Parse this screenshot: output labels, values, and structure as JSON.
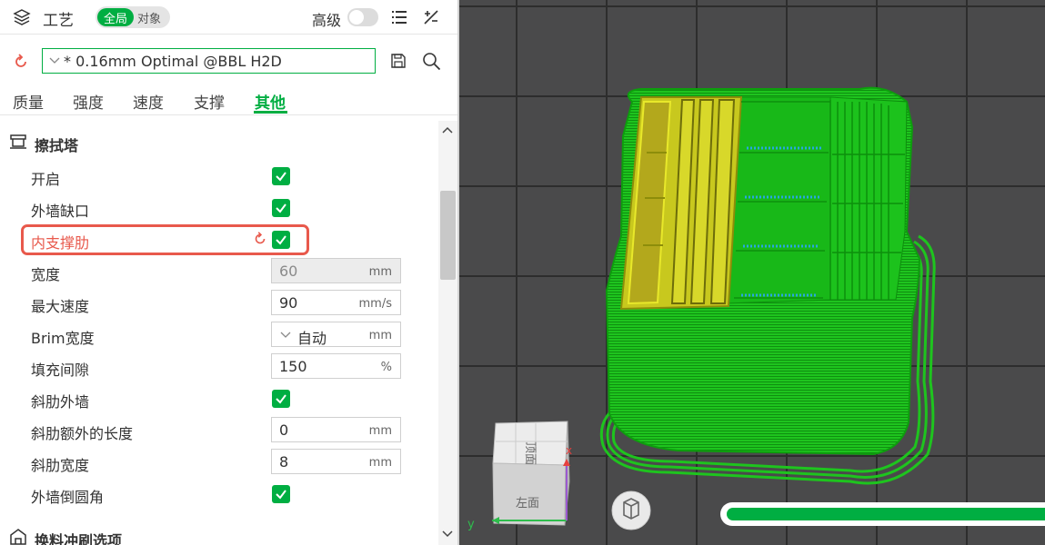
{
  "header": {
    "title": "工艺",
    "toggle_global": "全局",
    "toggle_object": "对象",
    "advanced_label": "高级"
  },
  "preset": {
    "value": "* 0.16mm Optimal @BBL H2D"
  },
  "tabs": [
    {
      "label": "质量",
      "active": false
    },
    {
      "label": "强度",
      "active": false
    },
    {
      "label": "速度",
      "active": false
    },
    {
      "label": "支撑",
      "active": false
    },
    {
      "label": "其他",
      "active": true
    }
  ],
  "section": {
    "title": "擦拭塔",
    "next_title": "换料冲刷选项"
  },
  "settings": {
    "enable": {
      "label": "开启",
      "checked": true
    },
    "outer_wall_gap": {
      "label": "外墙缺口",
      "checked": true
    },
    "inner_rib": {
      "label": "内支撑肋",
      "checked": true
    },
    "width": {
      "label": "宽度",
      "value": "60",
      "unit": "mm"
    },
    "max_speed": {
      "label": "最大速度",
      "value": "90",
      "unit": "mm/s"
    },
    "brim_width": {
      "label": "Brim宽度",
      "value": "自动",
      "unit": "mm"
    },
    "infill_gap": {
      "label": "填充间隙",
      "value": "150",
      "unit": "%"
    },
    "rib_wall": {
      "label": "斜肋外墙",
      "checked": true
    },
    "rib_extra_length": {
      "label": "斜肋额外的长度",
      "value": "0",
      "unit": "mm"
    },
    "rib_width": {
      "label": "斜肋宽度",
      "value": "8",
      "unit": "mm"
    },
    "fillet_wall": {
      "label": "外墙倒圆角",
      "checked": true
    }
  },
  "viewport": {
    "cube_top": "顶面",
    "cube_front": "左面",
    "axis_y": "y",
    "axis_x": "x",
    "progress": 1.0
  },
  "colors": {
    "accent": "#00ae42",
    "highlight": "#e8594c",
    "model_green": "#1ec41e",
    "model_yellow": "#e8e82a",
    "viewport_bg": "#4a4a4b"
  }
}
